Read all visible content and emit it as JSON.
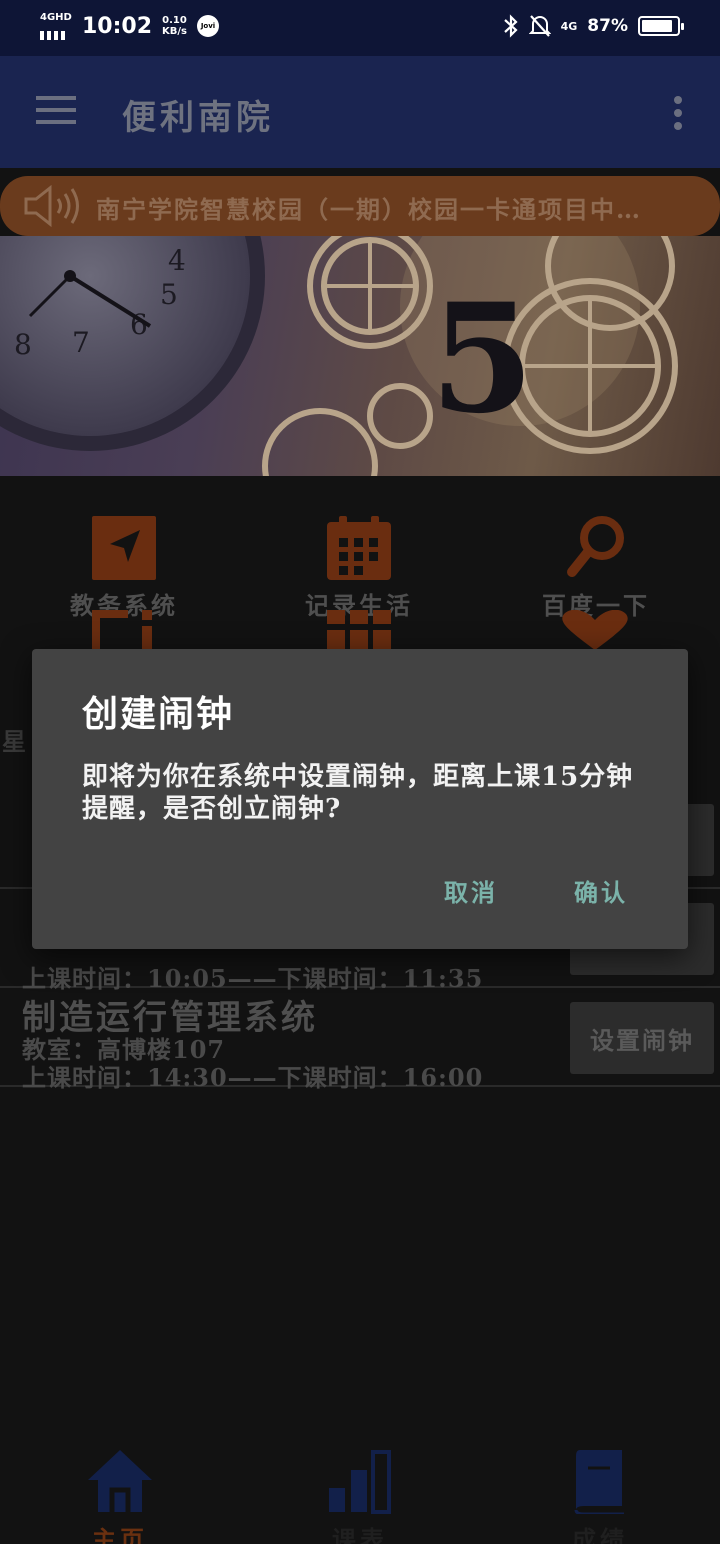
{
  "status_bar": {
    "network_tag": "4GHD",
    "time": "10:02",
    "speed_value": "0.10",
    "speed_unit": "KB/s",
    "jovi_badge": "Jovi",
    "mobile_data": "4G",
    "battery": "87%",
    "battery_level": 0.87
  },
  "app_bar": {
    "title": "便利南院"
  },
  "notice": {
    "text": "南宁学院智慧校园（一期）校园一卡通项目中…"
  },
  "grid": {
    "items": [
      {
        "label": "教务系统",
        "icon": "navigation-arrow-icon"
      },
      {
        "label": "记录生活",
        "icon": "calendar-icon"
      },
      {
        "label": "百度一下",
        "icon": "magnifier-icon"
      }
    ]
  },
  "weekday_prefix": "星",
  "courses": [
    {
      "name": "制造运行管理系统",
      "room": "教室：高博楼107",
      "time": "上课时间：14:30——下课时间：16:00",
      "button": "设置闹钟"
    }
  ],
  "partial_course_time": "上课时间：10:05——下课时间：11:35",
  "bottom_nav": [
    {
      "label": "主页",
      "icon": "home-icon",
      "active": true
    },
    {
      "label": "课表",
      "icon": "bar-chart-icon",
      "active": false
    },
    {
      "label": "成绩",
      "icon": "book-icon",
      "active": false
    }
  ],
  "dialog": {
    "title": "创建闹钟",
    "message": "即将为你在系统中设置闹钟，距离上课15分钟提醒，是否创立闹钟?",
    "cancel": "取消",
    "confirm": "确认"
  },
  "colors": {
    "accent_orange": "#c0501c",
    "app_bar": "#1a2450",
    "dialog_button": "#7bb3aa"
  }
}
